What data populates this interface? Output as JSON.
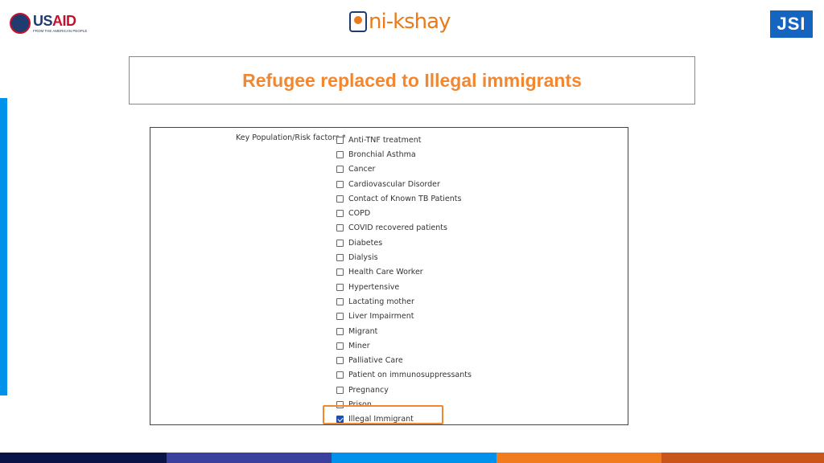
{
  "header": {
    "usaid_logo": {
      "name_blue": "US",
      "name_red": "AID",
      "tagline": "FROM THE AMERICAN PEOPLE"
    },
    "nikshay_logo": {
      "text": "ni-kshay"
    },
    "jsi_logo": {
      "text": "JSI"
    }
  },
  "slide": {
    "title": "Refugee replaced to Illegal immigrants"
  },
  "form": {
    "label": "Key Population/Risk factors *",
    "options": [
      {
        "label": "Anti-TNF treatment",
        "checked": false
      },
      {
        "label": "Bronchial Asthma",
        "checked": false
      },
      {
        "label": "Cancer",
        "checked": false
      },
      {
        "label": "Cardiovascular Disorder",
        "checked": false
      },
      {
        "label": "Contact of Known TB Patients",
        "checked": false
      },
      {
        "label": "COPD",
        "checked": false
      },
      {
        "label": "COVID recovered patients",
        "checked": false
      },
      {
        "label": "Diabetes",
        "checked": false
      },
      {
        "label": "Dialysis",
        "checked": false
      },
      {
        "label": "Health Care Worker",
        "checked": false
      },
      {
        "label": "Hypertensive",
        "checked": false
      },
      {
        "label": "Lactating mother",
        "checked": false
      },
      {
        "label": "Liver Impairment",
        "checked": false
      },
      {
        "label": "Migrant",
        "checked": false
      },
      {
        "label": "Miner",
        "checked": false
      },
      {
        "label": "Palliative Care",
        "checked": false
      },
      {
        "label": "Patient on immunosuppressants",
        "checked": false
      },
      {
        "label": "Pregnancy",
        "checked": false
      },
      {
        "label": "Prison",
        "checked": false
      },
      {
        "label": "Illegal Immigrant",
        "checked": true
      }
    ],
    "highlight_color": "#f2872f"
  },
  "theme": {
    "title_color": "#f2872f",
    "left_accent": "#0091ea",
    "stripe_colors": [
      "#0b1446",
      "#3b3f9e",
      "#0091ea",
      "#f07c1d",
      "#c8561a"
    ]
  }
}
